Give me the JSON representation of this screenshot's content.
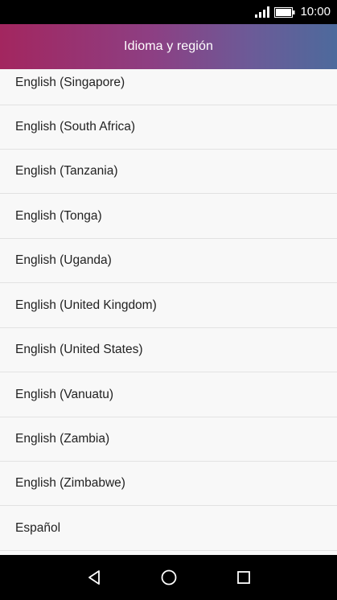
{
  "status_bar": {
    "time": "10:00"
  },
  "app_bar": {
    "title": "Idioma y región"
  },
  "list": {
    "items": [
      {
        "label": "English (Singapore)"
      },
      {
        "label": "English (South Africa)"
      },
      {
        "label": "English (Tanzania)"
      },
      {
        "label": "English (Tonga)"
      },
      {
        "label": "English (Uganda)"
      },
      {
        "label": "English (United Kingdom)"
      },
      {
        "label": "English (United States)"
      },
      {
        "label": "English (Vanuatu)"
      },
      {
        "label": "English (Zambia)"
      },
      {
        "label": "English (Zimbabwe)"
      },
      {
        "label": "Español"
      }
    ]
  },
  "nav_bar": {
    "icons": [
      "back-icon",
      "home-icon",
      "recents-icon"
    ]
  },
  "colors": {
    "app_bar_gradient_start": "#a3265f",
    "app_bar_gradient_end": "#4d6a9c",
    "list_background": "#f8f8f8",
    "divider": "#e2e2e2",
    "text": "#222222"
  }
}
